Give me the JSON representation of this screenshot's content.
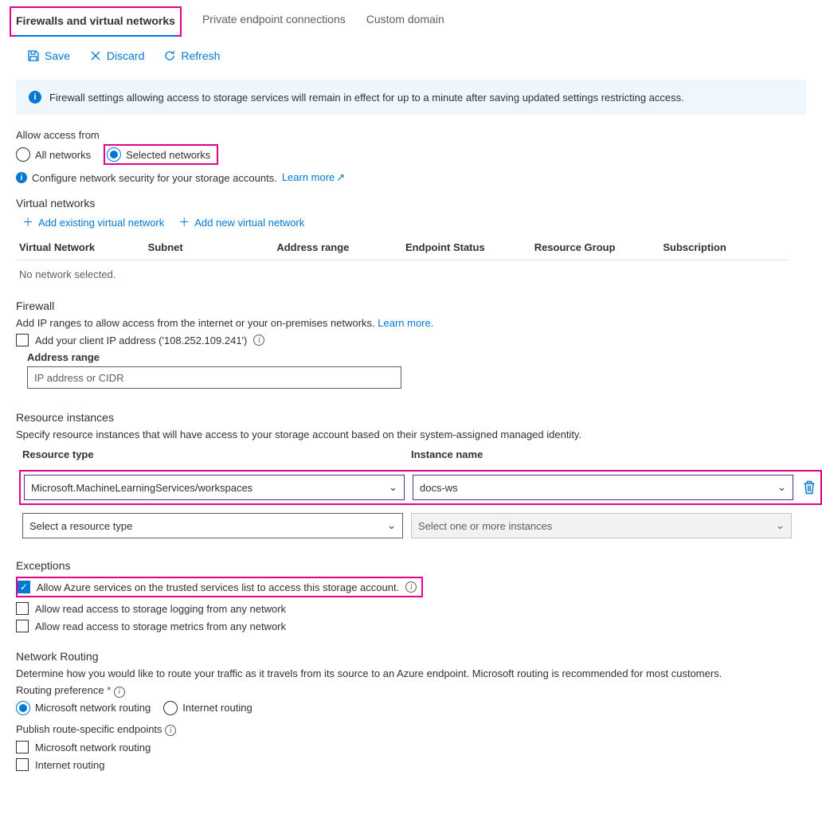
{
  "tabs": {
    "firewalls": "Firewalls and virtual networks",
    "private_endpoint": "Private endpoint connections",
    "custom_domain": "Custom domain"
  },
  "toolbar": {
    "save": "Save",
    "discard": "Discard",
    "refresh": "Refresh"
  },
  "info_banner": "Firewall settings allowing access to storage services will remain in effect for up to a minute after saving updated settings restricting access.",
  "access": {
    "label": "Allow access from",
    "all": "All networks",
    "selected": "Selected networks"
  },
  "network_hint": "Configure network security for your storage accounts.",
  "learn_more": "Learn more",
  "virtual_networks": {
    "heading": "Virtual networks",
    "add_existing": "Add existing virtual network",
    "add_new": "Add new virtual network",
    "cols": {
      "vn": "Virtual Network",
      "subnet": "Subnet",
      "range": "Address range",
      "endpoint": "Endpoint Status",
      "rg": "Resource Group",
      "sub": "Subscription"
    },
    "empty": "No network selected."
  },
  "firewall": {
    "heading": "Firewall",
    "desc": "Add IP ranges to allow access from the internet or your on-premises networks.",
    "learn": "Learn more.",
    "add_client_ip": "Add your client IP address ('108.252.109.241')",
    "range_label": "Address range",
    "placeholder": "IP address or CIDR"
  },
  "resource": {
    "heading": "Resource instances",
    "desc": "Specify resource instances that will have access to your storage account based on their system-assigned managed identity.",
    "col_type": "Resource type",
    "col_name": "Instance name",
    "row1_type": "Microsoft.MachineLearningServices/workspaces",
    "row1_name": "docs-ws",
    "row2_type_placeholder": "Select a resource type",
    "row2_name_placeholder": "Select one or more instances"
  },
  "exceptions": {
    "heading": "Exceptions",
    "trusted": "Allow Azure services on the trusted services list to access this storage account.",
    "logging": "Allow read access to storage logging from any network",
    "metrics": "Allow read access to storage metrics from any network"
  },
  "routing": {
    "heading": "Network Routing",
    "desc": "Determine how you would like to route your traffic as it travels from its source to an Azure endpoint. Microsoft routing is recommended for most customers.",
    "pref_label": "Routing preference",
    "opt_ms": "Microsoft network routing",
    "opt_internet": "Internet routing",
    "publish_label": "Publish route-specific endpoints",
    "cb_ms": "Microsoft network routing",
    "cb_internet": "Internet routing"
  }
}
